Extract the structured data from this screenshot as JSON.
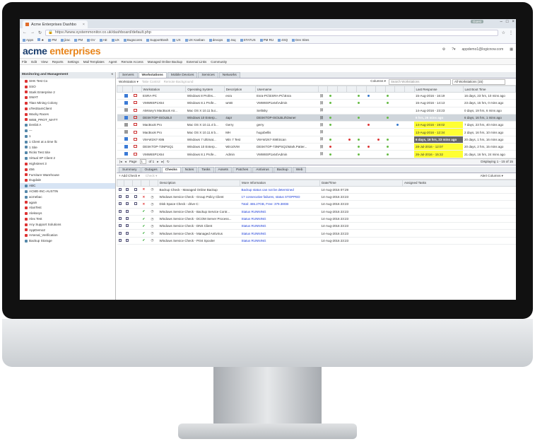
{
  "browser": {
    "tab_title": "Acme Enterprises Dashbo",
    "guest_label": "Guest",
    "url": "https://www.systemmonitor.co.uk/dashboard/default.php",
    "bookmarks": [
      "Apps",
      "★",
      "PM",
      "jirac",
      "PM",
      "GV",
      "AE",
      "UX",
      "Bugscores",
      "SupportDash",
      "UX",
      "UX Kanban",
      "devops",
      "4sq",
      "STATUS",
      "PM RU",
      "4SQ",
      "Dev Sites"
    ]
  },
  "app": {
    "logo_first": "acme",
    "logo_second": "enterprises",
    "user_email": "appdemo1@logicnow.com",
    "counts": "60   15",
    "menu": [
      "File",
      "Edit",
      "View",
      "Reports",
      "Settings",
      "Mail Templates",
      "Agent",
      "Remote Access",
      "Managed Online Backup",
      "External Links",
      "Community"
    ]
  },
  "sidebar": {
    "title": "Monitoring and Management",
    "items": [
      {
        "label": "SHK Test Co",
        "icon": "r"
      },
      {
        "label": "SSO",
        "icon": "r"
      },
      {
        "label": "Stark Enterprise 2",
        "icon": "r"
      },
      {
        "label": "SWAT",
        "icon": "r"
      },
      {
        "label": "Titan Mining Colony",
        "icon": "r"
      },
      {
        "label": "uTestSamClient",
        "icon": "r"
      },
      {
        "label": "Wacky Races",
        "icon": "r"
      },
      {
        "label": "WEB_PROT_MATT",
        "icon": "r"
      },
      {
        "label": "Denbit A",
        "icon": "b"
      },
      {
        "label": "---",
        "icon": "b"
      },
      {
        "label": "1",
        "icon": "b"
      },
      {
        "label": "1 Client at a time llc",
        "icon": "b"
      },
      {
        "label": "1 Site",
        "icon": "b"
      },
      {
        "label": "Ricks Test Site",
        "icon": "b"
      },
      {
        "label": "Virtual XP Client 2",
        "icon": "b"
      },
      {
        "label": "Highstreet 3",
        "icon": "r"
      },
      {
        "label": "456",
        "icon": "r"
      },
      {
        "label": "Furniture Warehouse",
        "icon": "r"
      },
      {
        "label": "Dugdale",
        "icon": "r"
      },
      {
        "label": "ABC",
        "icon": "b",
        "selected": true
      },
      {
        "label": "ACME-INC-AUSTIN",
        "icon": "b"
      },
      {
        "label": "acmebac",
        "icon": "b"
      },
      {
        "label": "again",
        "icon": "r"
      },
      {
        "label": "AlanTest",
        "icon": "r"
      },
      {
        "label": "Alekseys",
        "icon": "r"
      },
      {
        "label": "Alex Test",
        "icon": "r"
      },
      {
        "label": "Any Support Solutions",
        "icon": "r"
      },
      {
        "label": "AppDemo2",
        "icon": "r"
      },
      {
        "label": "Arsenal_Verification",
        "icon": "r"
      },
      {
        "label": "Backup Storage",
        "icon": "b"
      }
    ]
  },
  "top_tabs": [
    "Servers",
    "Workstations",
    "Mobile Devices",
    "Services",
    "Networks"
  ],
  "toolbar": {
    "workstation": "Workstation ▾",
    "take_control": "Take Control",
    "remote_bg": "Remote Background",
    "columns": "Columns ▾",
    "search_placeholder": "Search Workstations",
    "filter": "All Workstations (15)"
  },
  "ws_headers": [
    "",
    "",
    "",
    "Workstation",
    "Operating System",
    "Description",
    "Username",
    "",
    "",
    "",
    "",
    "",
    "",
    "",
    "",
    "",
    "",
    "Last Response",
    "Last Boot Time"
  ],
  "workstations": [
    {
      "name": "ESRA-PC",
      "os": "Windows 8 Profes...",
      "desc": "esra",
      "user": "Esra-PC\\ESRA-PC\\Esra",
      "last": "15-Aug-2016 - 16:19",
      "boot": "16 days, 23 hrs, 10 mins ago",
      "style": ""
    },
    {
      "name": "VMW8SP1X64",
      "os": "Windows 8.1 Profe...",
      "desc": "wmB",
      "user": "VMW8SP1x64\\Admin",
      "last": "15-Aug-2016 - 14:13",
      "boot": "23 days, 15 hrs, 0 mins ago",
      "style": ""
    },
    {
      "name": "Aleksey's MacBook Air...",
      "os": "Mac OS X 10.11 bui...",
      "desc": "",
      "user": "Selitsky",
      "last": "14-Aug-2016 - 23:23",
      "boot": "0 days, 19 hrs, 6 mins ago",
      "style": ""
    },
    {
      "name": "DESKTOP-ISOLBL0",
      "os": "Windows 10 Enterp...",
      "desc": "4apr",
      "user": "DESKTOP-ISOLBL0\\Owner",
      "last": "6 hrs, 26 mins ago",
      "boot": "6 days, 16 hrs, 1 mins ago",
      "style": "dark",
      "selected": true
    },
    {
      "name": "MacBook Pro",
      "os": "Mac OS X 10.11.4 b...",
      "desc": "Gerry",
      "user": "gerry",
      "last": "14-Aug-2016 - 19:02",
      "boot": "7 days, 23 hrs, 40 mins ago",
      "style": "yellow"
    },
    {
      "name": "MacBook Pro",
      "os": "Mac OS X 10.11.6 b...",
      "desc": "MH",
      "user": "hugobellis",
      "last": "13-Aug-2016 - 12:34",
      "boot": "2 days, 16 hrs, 10 mins ago",
      "style": "yellow"
    },
    {
      "name": "VM-W1N7-X86",
      "os": "Windows 7 Ultimat...",
      "desc": "Win 7 Test",
      "user": "VM-W1N7-X86\\Scan",
      "last": "6 days, 16 hrs, 23 mins ago",
      "boot": "20 days, 1 hrs, 16 mins ago",
      "style": "dark"
    },
    {
      "name": "DESKTOP-73NPSQ1",
      "os": "Windows 10 Enterp...",
      "desc": "Win10VM",
      "user": "DESKTOP-73NPSQ1\\Mark.Patter...",
      "last": "28-Jul-2016 - 12:07",
      "boot": "20 days, 2 hrs, 15 mins ago",
      "style": "yellow"
    },
    {
      "name": "VMW8SP1X64",
      "os": "Windows 8.1 Profe...",
      "desc": "Admin",
      "user": "VMW8SP1x64\\Admin",
      "last": "26-Jul-2016 - 15:32",
      "boot": "21 days, 16 hrs, 24 mins ago",
      "style": "yellow"
    }
  ],
  "pager": {
    "page_label": "Page",
    "page": "1",
    "of": "of 1",
    "display": "Displaying 1 - 15 of 15"
  },
  "bottom_tabs": [
    "Summary",
    "Outages",
    "Checks",
    "Notes",
    "Tasks",
    "Assets",
    "Patches",
    "Antivirus",
    "Backup",
    "Web"
  ],
  "checks_toolbar": {
    "add_check": "+ Add Check ▾",
    "check": "Check ▾",
    "alert_columns": "Alert Columns ▾"
  },
  "check_headers": [
    "",
    "",
    "",
    "",
    "",
    "Description",
    "More Information",
    "Date/Time",
    "Assigned Tasks"
  ],
  "checks": [
    {
      "status": "x",
      "desc": "Backup Check - Managed Online Backup",
      "info": "Backup status can not be determined",
      "date": "14-Aug-2016 07:29"
    },
    {
      "status": "x",
      "desc": "Windows Service Check - Group Policy Client",
      "info": "17 consecutive failures, status STOPPED",
      "date": "14-Aug-2016 23:23"
    },
    {
      "status": "x",
      "desc": "Disk Space Check - drive C:",
      "info": "Total: 465.27GB, Free: 379.38GB",
      "date": "14-Aug-2016 23:23"
    },
    {
      "status": "v",
      "desc": "Windows Service Check - Backup Service Contr...",
      "info": "Status RUNNING",
      "date": "14-Aug-2016 23:23"
    },
    {
      "status": "v",
      "desc": "Windows Service Check - DCOM Server Process...",
      "info": "Status RUNNING",
      "date": "14-Aug-2016 23:23"
    },
    {
      "status": "v",
      "desc": "Windows Service Check - DNS Client",
      "info": "Status RUNNING",
      "date": "14-Aug-2016 23:23"
    },
    {
      "status": "v",
      "desc": "Windows Service Check - Managed Antivirus",
      "info": "Status RUNNING",
      "date": "14-Aug-2016 23:23"
    },
    {
      "status": "v",
      "desc": "Windows Service Check - Print Spooler",
      "info": "Status RUNNING",
      "date": "14-Aug-2016 23:23"
    }
  ]
}
